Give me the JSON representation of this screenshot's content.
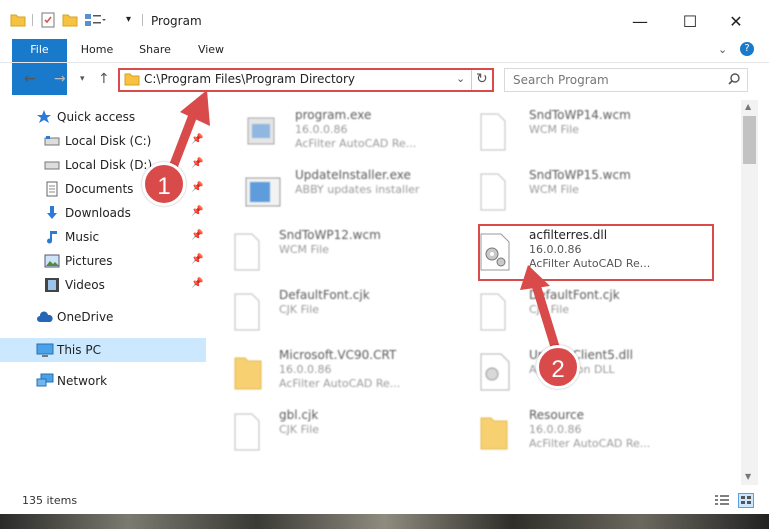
{
  "window": {
    "title": "Program",
    "minimize_glyph": "—",
    "maximize_glyph": "☐",
    "close_glyph": "✕"
  },
  "ribbon": {
    "tabs": [
      "File",
      "Home",
      "Share",
      "View"
    ],
    "help_glyph": "?"
  },
  "address": {
    "path": "C:\\Program Files\\Program Directory",
    "search_placeholder": "Search Program"
  },
  "sidebar": {
    "items": [
      {
        "label": "Quick access",
        "icon": "star-icon"
      },
      {
        "label": "Local Disk (C:)",
        "icon": "drive-icon"
      },
      {
        "label": "Local Disk (D:)",
        "icon": "drive-icon"
      },
      {
        "label": "Documents",
        "icon": "documents-icon"
      },
      {
        "label": "Downloads",
        "icon": "download-icon"
      },
      {
        "label": "Music",
        "icon": "music-icon"
      },
      {
        "label": "Pictures",
        "icon": "pictures-icon"
      },
      {
        "label": "Videos",
        "icon": "videos-icon"
      },
      {
        "label": "OneDrive",
        "icon": "cloud-icon"
      },
      {
        "label": "This PC",
        "icon": "computer-icon"
      },
      {
        "label": "Network",
        "icon": "network-icon"
      }
    ]
  },
  "files": [
    {
      "name": "program.exe",
      "line2": "16.0.0.86",
      "line3": "AcFilter AutoCAD Re..."
    },
    {
      "name": "SndToWP14.wcm",
      "line2": "WCM File",
      "line3": ""
    },
    {
      "name": "UpdateInstaller.exe",
      "line2": "ABBY updates installer",
      "line3": ""
    },
    {
      "name": "SndToWP15.wcm",
      "line2": "WCM File",
      "line3": ""
    },
    {
      "name": "SndToWP12.wcm",
      "line2": "WCM File",
      "line3": ""
    },
    {
      "name": "acfilterres.dll",
      "line2": "16.0.0.86",
      "line3": "AcFilter AutoCAD Re..."
    },
    {
      "name": "DefaultFont.cjk",
      "line2": "CJK File",
      "line3": ""
    },
    {
      "name": "DefaultFont.cjk",
      "line2": "CJK File",
      "line3": ""
    },
    {
      "name": "Microsoft.VC90.CRT",
      "line2": "16.0.0.86",
      "line3": "AcFilter AutoCAD Re..."
    },
    {
      "name": "UpdateClient5.dll",
      "line2": "Application DLL",
      "line3": ""
    },
    {
      "name": "gbl.cjk",
      "line2": "CJK File",
      "line3": ""
    },
    {
      "name": "Resource",
      "line2": "16.0.0.86",
      "line3": "AcFilter AutoCAD Re..."
    }
  ],
  "status": {
    "item_count": "135 items"
  },
  "annotations": {
    "step1": "1",
    "step2": "2"
  },
  "colors": {
    "accent": "#1979ca",
    "highlight": "#d94a4a",
    "selected": "#cce8ff"
  }
}
